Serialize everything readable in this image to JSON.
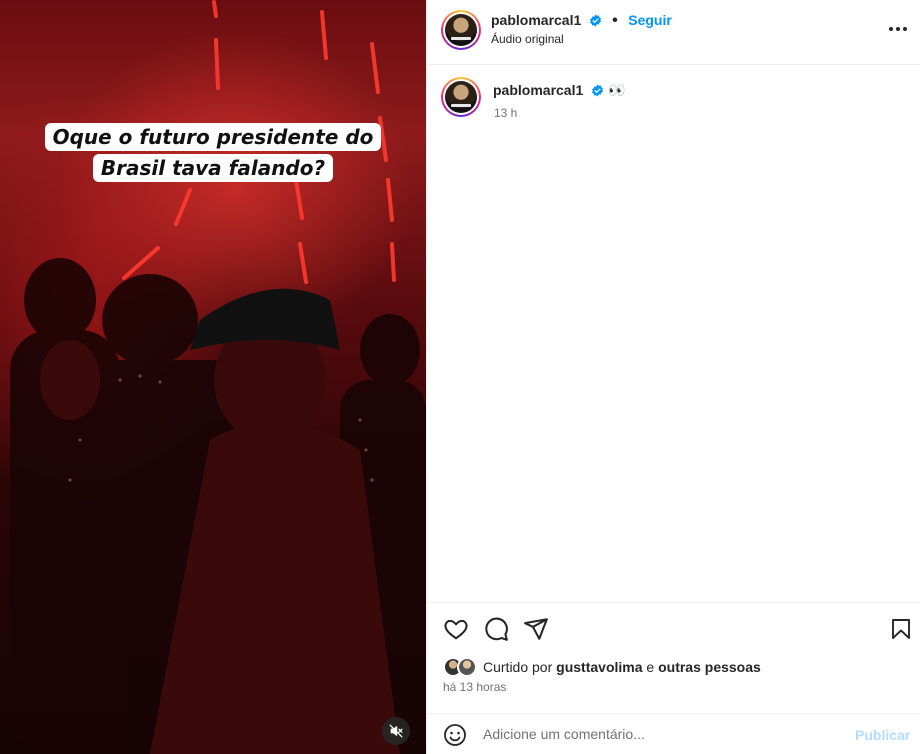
{
  "video": {
    "caption_line1": "Oque o futuro presidente do",
    "caption_line2": "Brasil tava falando?",
    "mute_icon": "muted-speaker-icon"
  },
  "header": {
    "username": "pabloмarcal1",
    "dot": "•",
    "follow_label": "Seguir",
    "audio_label": "Áudio original",
    "more_icon": "more-options-icon"
  },
  "post_caption": {
    "username": "pablomarcal1",
    "text": "👀",
    "time": "13 h"
  },
  "actions": {
    "like_icon": "heart-icon",
    "comment_icon": "comment-icon",
    "share_icon": "send-icon",
    "save_icon": "bookmark-icon"
  },
  "likes": {
    "prefix": "Curtido por",
    "user": "gusttavolima",
    "connector": "e",
    "others": "outras pessoas"
  },
  "time_ago": "há 13 horas",
  "comment_box": {
    "emoji_icon": "emoji-icon",
    "placeholder": "Adicione um comentário...",
    "publish_label": "Publicar"
  },
  "colors": {
    "accent": "#0095f6",
    "publish_disabled": "#b3dbff",
    "verified": "#0095f6"
  }
}
